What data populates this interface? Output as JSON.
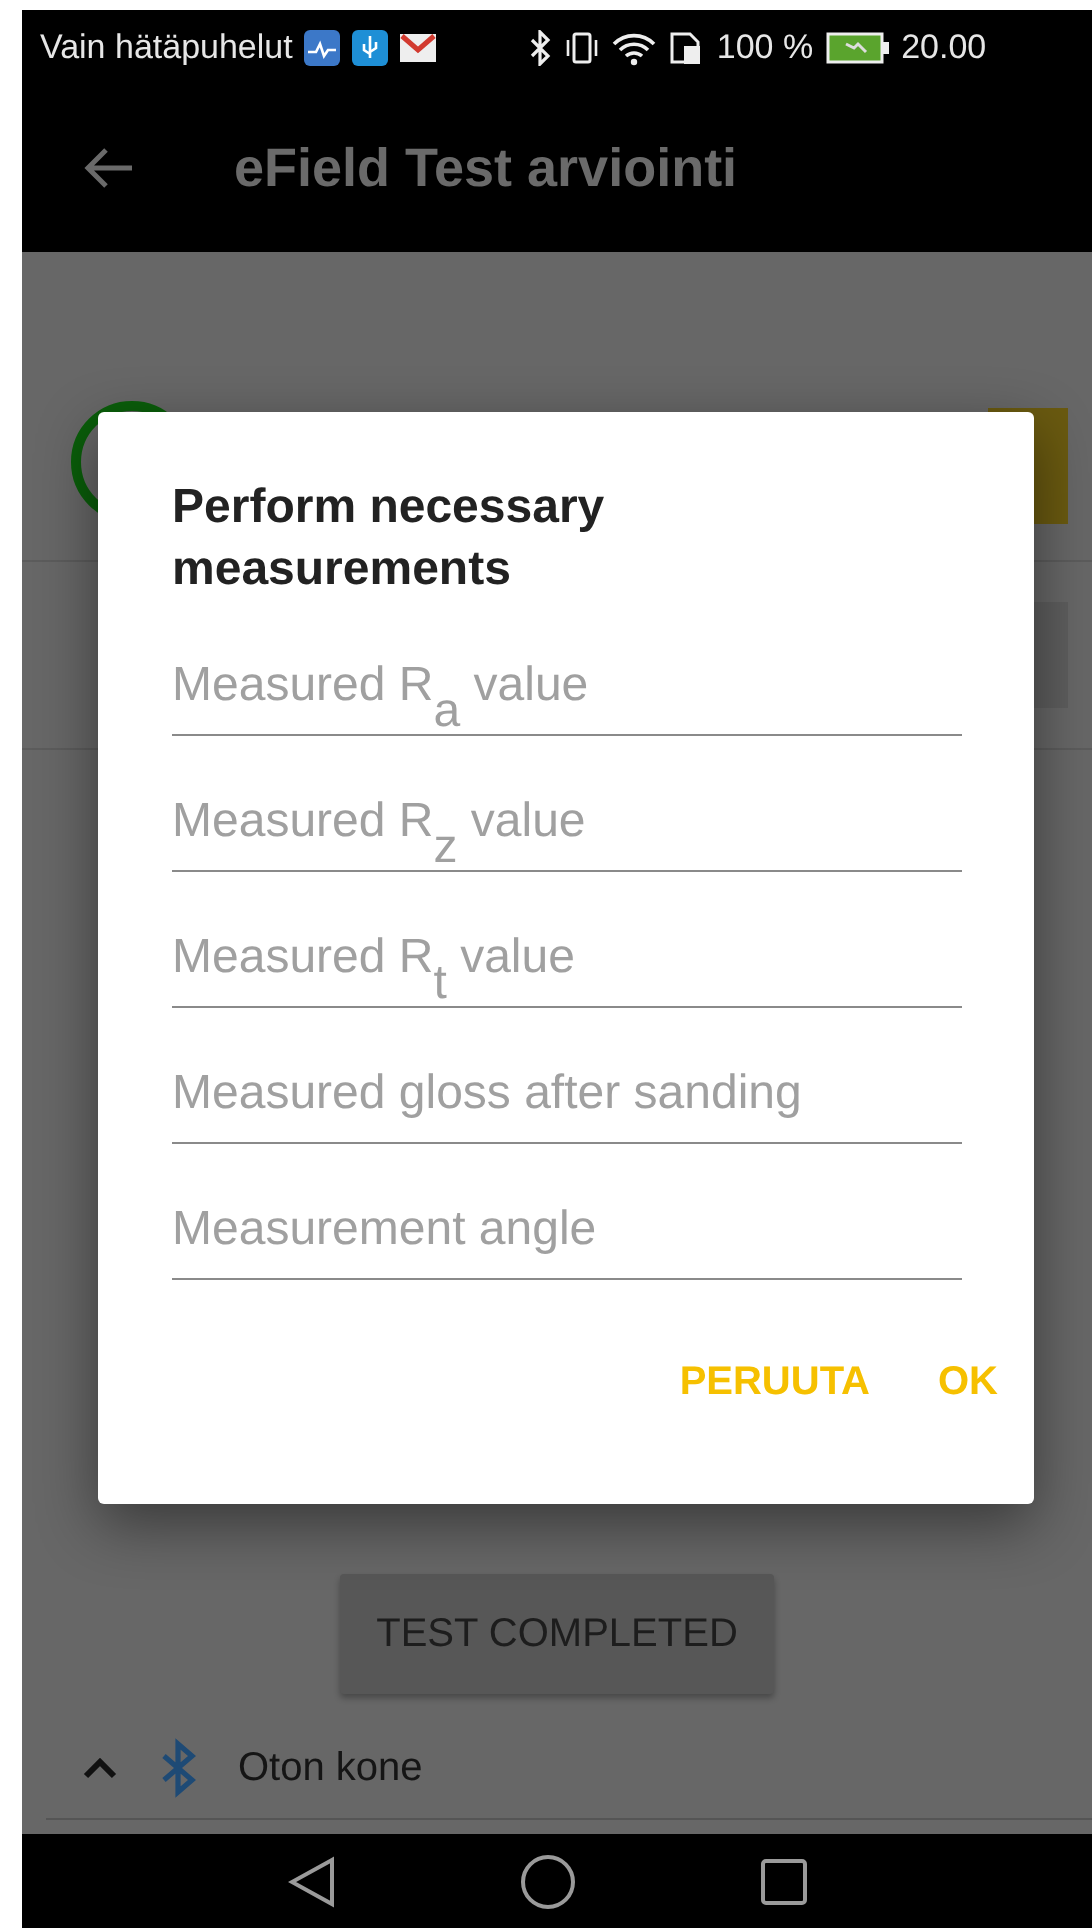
{
  "status_bar": {
    "carrier": "Vain hätäpuhelut",
    "battery": "100 %",
    "time": "20.00"
  },
  "app_bar": {
    "title": "eField Test arviointi"
  },
  "dialog": {
    "title": "Perform necessary measurements",
    "fields": [
      {
        "placeholder": "Measured R$_{a}$ value"
      },
      {
        "placeholder": "Measured R$_{z}$ value"
      },
      {
        "placeholder": "Measured R$_{t}$ value"
      },
      {
        "placeholder": "Measured gloss after sanding"
      },
      {
        "placeholder": "Measurement angle"
      }
    ],
    "buttons": [
      "PERUUTA",
      "OK"
    ]
  },
  "content": {
    "complete_button": "TEST COMPLETED",
    "device": {
      "name": "Oton kone",
      "expanded": true
    }
  }
}
